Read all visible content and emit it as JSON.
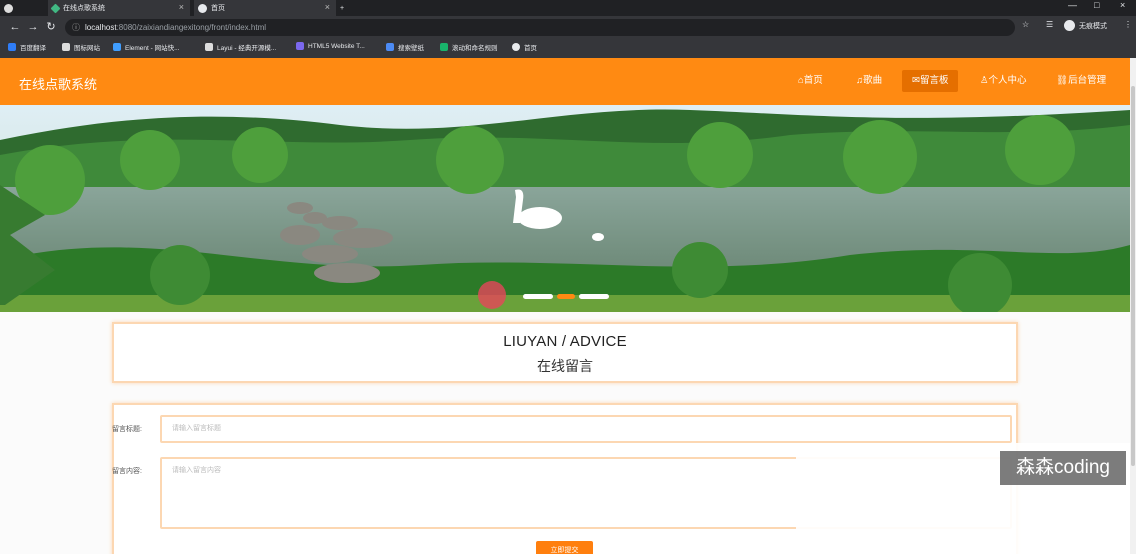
{
  "browser": {
    "tabs": [
      {
        "title": "在线点歌系统"
      },
      {
        "title": "首页"
      }
    ],
    "url_host": "localhost",
    "url_path": ":8080/zaixiandiangexitong/front/index.html",
    "profile": "无痕模式",
    "bookmarks": [
      "百度翻译",
      "图标网站",
      "Element - 网站快...",
      "Layui - 经典开源模...",
      "HTML5 Website T...",
      "搜索壁纸",
      "滚动和命名规则",
      "首页"
    ]
  },
  "site": {
    "title": "在线点歌系统",
    "menu": [
      "首页",
      "歌曲",
      "留言板",
      "个人中心",
      "后台管理"
    ],
    "menu_icons": [
      "home-icon",
      "music-icon",
      "message-icon",
      "user-icon",
      "link-icon"
    ]
  },
  "advice": {
    "title": "LIUYAN / ADVICE",
    "subtitle": "在线留言"
  },
  "form": {
    "title_label": "留言标题:",
    "title_placeholder": "请输入留言标题",
    "content_label": "留言内容:",
    "content_placeholder": "请输入留言内容",
    "submit_label": "立即提交"
  },
  "watermark": "森森coding",
  "colors": {
    "primary": "#ff8a12",
    "active_menu": "#e56f00",
    "border": "#fcd7b2"
  }
}
